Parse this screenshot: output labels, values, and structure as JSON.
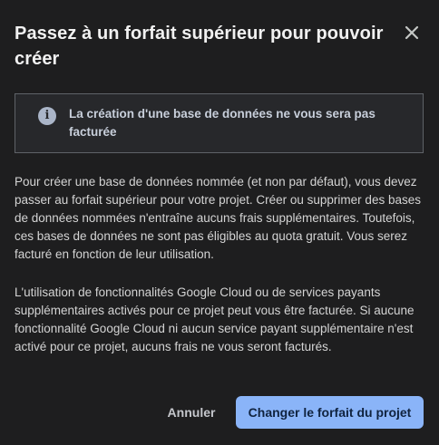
{
  "dialog": {
    "title": "Passez à un forfait supérieur pour pouvoir créer",
    "close_icon": "close-icon",
    "notice": {
      "icon": "info-icon",
      "icon_glyph": "i",
      "text": "La création d'une base de données ne vous sera pas facturée"
    },
    "paragraphs": [
      "Pour créer une base de données nommée (et non par défaut), vous devez passer au forfait supérieur pour votre projet. Créer ou supprimer des bases de données nommées n'entraîne aucuns frais supplémentaires. Toutefois, ces bases de données ne sont pas éligibles au quota gratuit. Vous serez facturé en fonction de leur utilisation.",
      "L'utilisation de fonctionnalités Google Cloud ou de services payants supplémentaires activés pour ce projet peut vous être facturée. Si aucune fonctionnalité Google Cloud ni aucun service payant supplémentaire n'est activé pour ce projet, aucuns frais ne vous seront facturés."
    ],
    "actions": {
      "cancel_label": "Annuler",
      "confirm_label": "Changer le forfait du projet"
    }
  },
  "colors": {
    "background": "#1e1e1f",
    "primary_button": "#8ab4f8",
    "notice_border": "#5f6368",
    "notice_icon": "#aab5c8"
  }
}
